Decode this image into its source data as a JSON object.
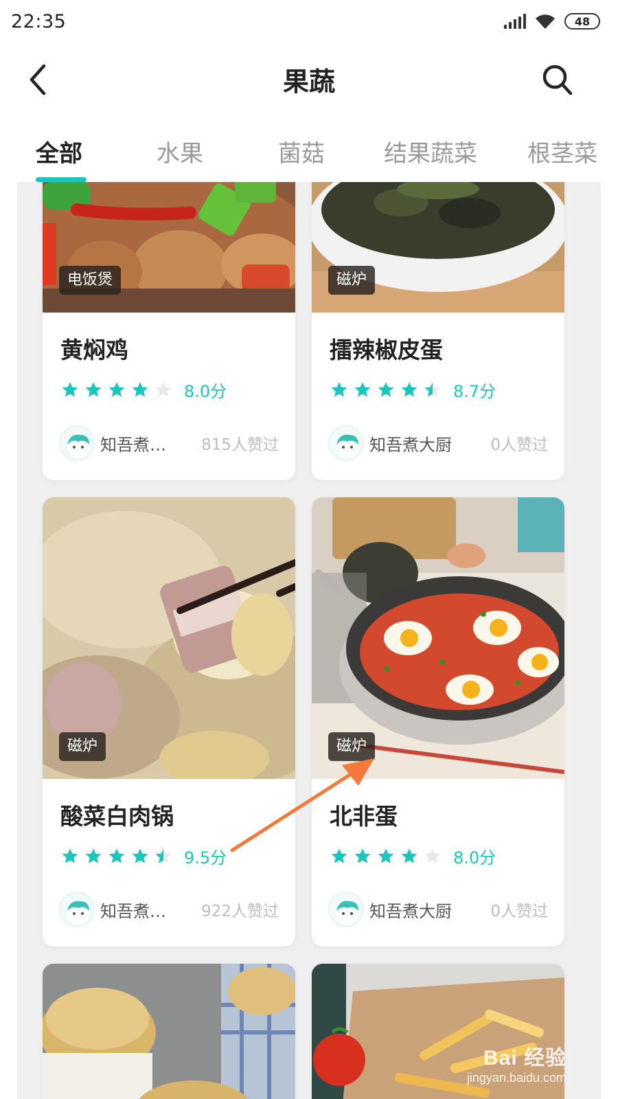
{
  "status_bar": {
    "time": "22:35",
    "battery": "48",
    "icons": [
      "signal-icon",
      "wifi-icon",
      "battery-icon"
    ]
  },
  "header": {
    "title": "果蔬",
    "back_icon": "back-chevron-icon",
    "search_icon": "search-icon"
  },
  "tabs": [
    {
      "label": "全部",
      "active": true
    },
    {
      "label": "水果",
      "active": false
    },
    {
      "label": "菌菇",
      "active": false
    },
    {
      "label": "结果蔬菜",
      "active": false
    },
    {
      "label": "根茎菜",
      "active": false
    }
  ],
  "colors": {
    "accent": "#1dc6bc",
    "arrow": "#f47a3b"
  },
  "recipes": [
    {
      "device": "电饭煲",
      "title": "黄焖鸡",
      "rating": 8.0,
      "rating_label": "8.0分",
      "stars_filled": 4,
      "author": "知吾煮…",
      "likes": "815人赞过"
    },
    {
      "device": "磁炉",
      "title": "擂辣椒皮蛋",
      "rating": 8.7,
      "rating_label": "8.7分",
      "stars_filled": 4.5,
      "author": "知吾煮大厨",
      "likes": "0人赞过"
    },
    {
      "device": "磁炉",
      "title": "酸菜白肉锅",
      "rating": 9.5,
      "rating_label": "9.5分",
      "stars_filled": 4.5,
      "author": "知吾煮…",
      "likes": "922人赞过"
    },
    {
      "device": "磁炉",
      "title": "北非蛋",
      "rating": 8.0,
      "rating_label": "8.0分",
      "stars_filled": 4,
      "author": "知吾煮大厨",
      "likes": "0人赞过"
    }
  ],
  "watermark": {
    "main": "Bai 经验",
    "sub": "jingyan.baidu.com"
  }
}
